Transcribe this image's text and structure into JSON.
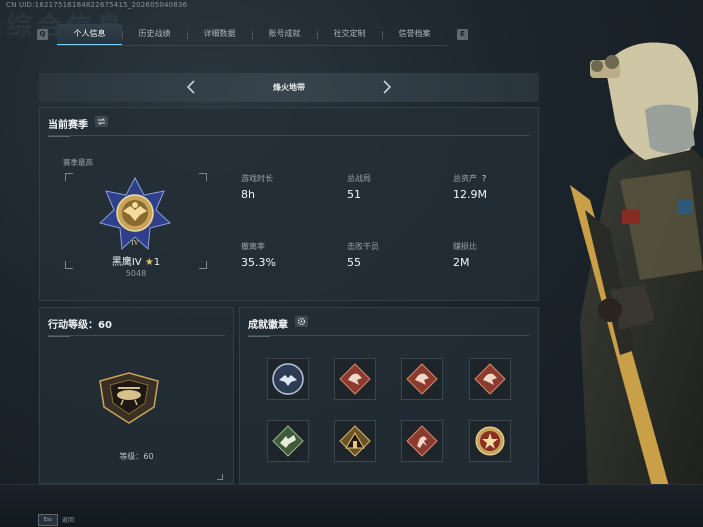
{
  "header": {
    "uid": "CN UID:16217516184822675415_202605040836",
    "watermark": "综合信息"
  },
  "tabs": [
    {
      "label": "个人信息",
      "active": true
    },
    {
      "label": "历史战绩",
      "active": false
    },
    {
      "label": "详细数据",
      "active": false
    },
    {
      "label": "账号成就",
      "active": false
    },
    {
      "label": "社交定制",
      "active": false
    },
    {
      "label": "信誉档案",
      "active": false
    }
  ],
  "key_hints": {
    "left": "Q",
    "right": "E"
  },
  "mode": {
    "title": "烽火地带"
  },
  "season": {
    "title": "当前赛季",
    "peak_label": "赛季最高",
    "rank_name": "黑鹰IV",
    "rank_star": "★",
    "rank_star_count": "1",
    "rank_score": "5048",
    "stats": [
      {
        "label": "游戏时长",
        "value": "8h"
      },
      {
        "label": "总战局",
        "value": "51"
      },
      {
        "label": "总资产",
        "value": "12.9M",
        "help": "?"
      },
      {
        "label": "撤离率",
        "value": "35.3%"
      },
      {
        "label": "击败干员",
        "value": "55"
      },
      {
        "label": "赚损比",
        "value": "2M"
      }
    ]
  },
  "level": {
    "title": "行动等级：60",
    "text": "等级：60"
  },
  "achievements": {
    "title": "成就徽章",
    "badges": [
      {
        "icon": "eagle-round-badge-icon"
      },
      {
        "icon": "red-diamond-beast-badge-icon"
      },
      {
        "icon": "red-diamond-beast-badge-icon"
      },
      {
        "icon": "red-diamond-beast-badge-icon"
      },
      {
        "icon": "green-diamond-eagle-badge-icon"
      },
      {
        "icon": "gold-pyramid-badge-icon"
      },
      {
        "icon": "red-diamond-runner-badge-icon"
      },
      {
        "icon": "gold-star-seal-badge-icon"
      }
    ]
  },
  "footer": {
    "key": "Esc",
    "label": "返回"
  },
  "colors": {
    "accent": "#7bd4ff",
    "panel": "#242e36",
    "gold": "#c9a55c",
    "badge_red": "#8a3a2e"
  }
}
